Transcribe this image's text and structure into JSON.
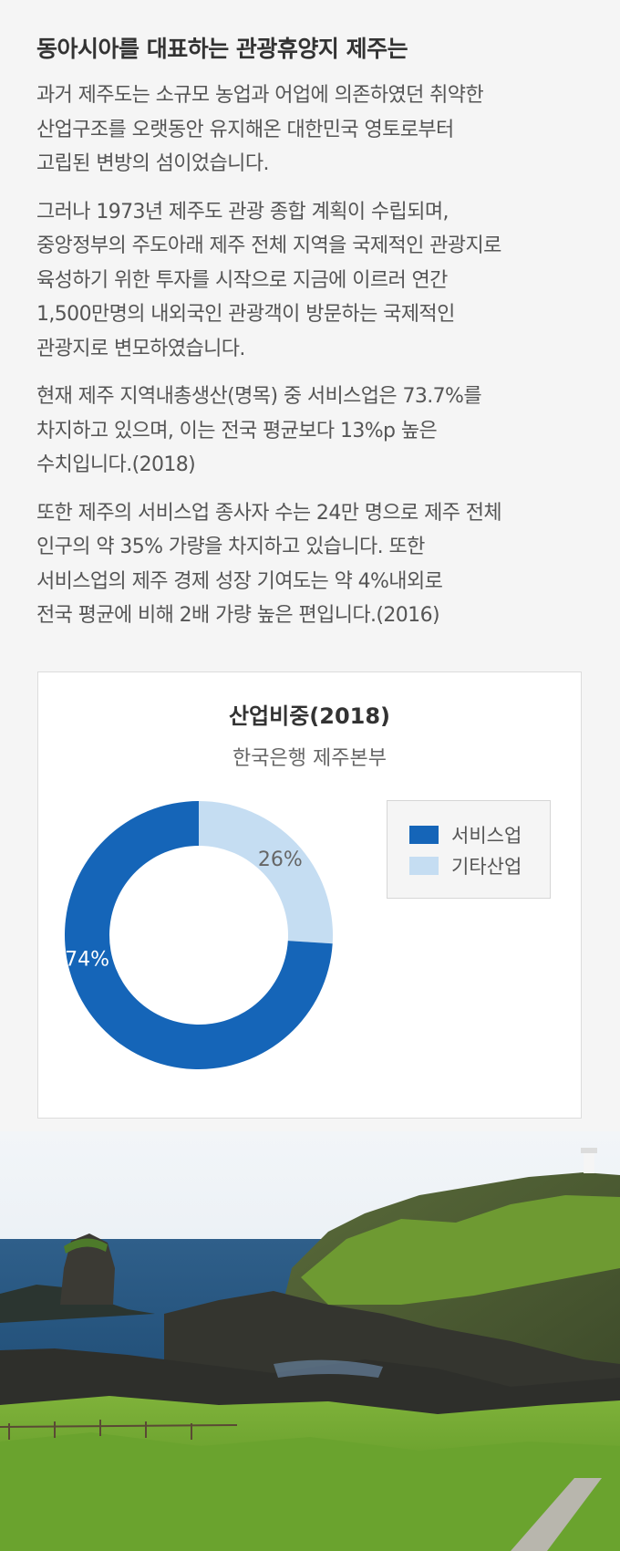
{
  "article": {
    "heading": "동아시아를 대표하는 관광휴양지 제주는",
    "paragraphs": [
      [
        "과거 제주도는 소규모 농업과 어업에 의존하였던 취약한",
        "산업구조를 오랫동안 유지해온 대한민국 영토로부터",
        "고립된 변방의 섬이었습니다."
      ],
      [
        "그러나 1973년 제주도 관광 종합 계획이 수립되며,",
        "중앙정부의 주도아래 제주 전체 지역을 국제적인 관광지로",
        "육성하기 위한 투자를 시작으로 지금에 이르러 연간",
        "1,500만명의 내외국인 관광객이 방문하는 국제적인",
        "관광지로 변모하였습니다."
      ],
      [
        "현재 제주 지역내총생산(명목) 중 서비스업은 73.7%를",
        "차지하고 있으며, 이는 전국 평균보다 13%p 높은",
        "수치입니다.(2018)"
      ],
      [
        "또한 제주의 서비스업 종사자 수는 24만 명으로 제주 전체",
        "인구의 약 35% 가량을 차지하고 있습니다. 또한",
        "서비스업의 제주 경제 성장 기여도는 약 4%내외로",
        "전국 평균에 비해 2배 가량 높은 편입니다.(2016)"
      ]
    ]
  },
  "chart_data": {
    "type": "pie",
    "title": "산업비중(2018)",
    "subtitle": "한국은행 제주본부",
    "donut": true,
    "series": [
      {
        "name": "서비스업",
        "value": 74,
        "label": "74%",
        "color": "#1565b8"
      },
      {
        "name": "기타산업",
        "value": 26,
        "label": "26%",
        "color": "#c5ddf2"
      }
    ],
    "legend_placement": "right"
  },
  "photo": {
    "description_icon": "jeju-coastline-photo"
  }
}
